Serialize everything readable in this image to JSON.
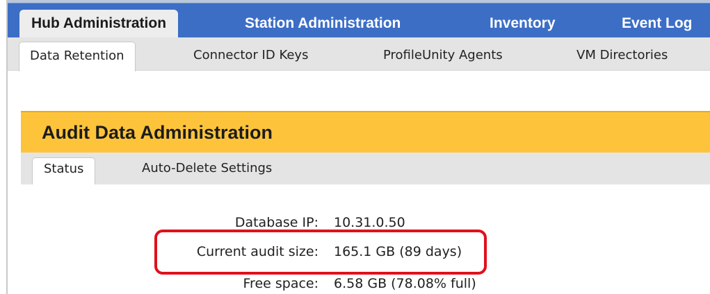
{
  "main_nav": {
    "tabs": [
      {
        "label": "Hub Administration",
        "active": true
      },
      {
        "label": "Station Administration",
        "active": false
      },
      {
        "label": "Inventory",
        "active": false
      },
      {
        "label": "Event Log",
        "active": false
      }
    ]
  },
  "sub_nav": {
    "tabs": [
      {
        "label": "Data Retention",
        "active": true
      },
      {
        "label": "Connector ID Keys",
        "active": false
      },
      {
        "label": "ProfileUnity Agents",
        "active": false
      },
      {
        "label": "VM Directories",
        "active": false
      }
    ]
  },
  "panel": {
    "title": "Audit Data Administration",
    "tabs": [
      {
        "label": "Status",
        "active": true
      },
      {
        "label": "Auto-Delete Settings",
        "active": false
      }
    ],
    "status": [
      {
        "label": "Database IP:",
        "value": "10.31.0.50"
      },
      {
        "label": "Current audit size:",
        "value": "165.1 GB (89 days)"
      },
      {
        "label": "Free space:",
        "value": "6.58 GB (78.08% full)"
      }
    ]
  },
  "colors": {
    "nav_blue": "#3c6ec6",
    "panel_gold": "#fdc43b",
    "highlight_red": "#e0101c"
  }
}
